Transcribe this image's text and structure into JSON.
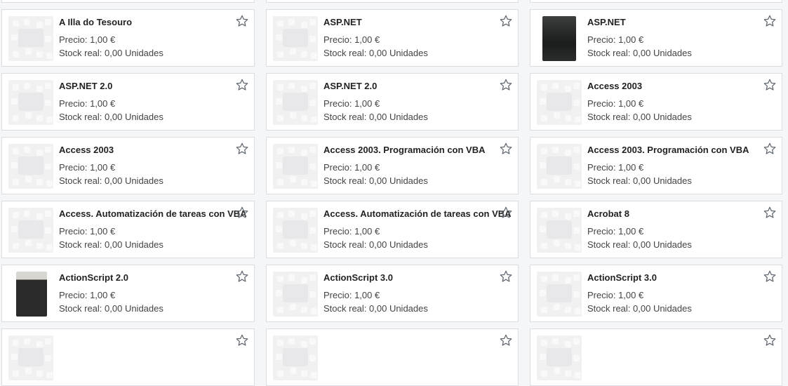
{
  "products": [
    {
      "title": "",
      "price": "",
      "stock": "",
      "cover": false,
      "partial": true
    },
    {
      "title": "",
      "price": "",
      "stock": "",
      "cover": false,
      "partial": true
    },
    {
      "title": "",
      "price": "",
      "stock": "",
      "cover": false,
      "partial": true
    },
    {
      "title": "A Illa do Tesouro",
      "price": "Precio: 1,00 €",
      "stock": "Stock real: 0,00 Unidades",
      "cover": false
    },
    {
      "title": "ASP.NET",
      "price": "Precio: 1,00 €",
      "stock": "Stock real: 0,00 Unidades",
      "cover": false
    },
    {
      "title": "ASP.NET",
      "price": "Precio: 1,00 €",
      "stock": "Stock real: 0,00 Unidades",
      "cover": "a"
    },
    {
      "title": "ASP.NET 2.0",
      "price": "Precio: 1,00 €",
      "stock": "Stock real: 0,00 Unidades",
      "cover": false
    },
    {
      "title": "ASP.NET 2.0",
      "price": "Precio: 1,00 €",
      "stock": "Stock real: 0,00 Unidades",
      "cover": false
    },
    {
      "title": "Access 2003",
      "price": "Precio: 1,00 €",
      "stock": "Stock real: 0,00 Unidades",
      "cover": false
    },
    {
      "title": "Access 2003",
      "price": "Precio: 1,00 €",
      "stock": "Stock real: 0,00 Unidades",
      "cover": false
    },
    {
      "title": "Access 2003. Programación con VBA",
      "price": "Precio: 1,00 €",
      "stock": "Stock real: 0,00 Unidades",
      "cover": false
    },
    {
      "title": "Access 2003. Programación con VBA",
      "price": "Precio: 1,00 €",
      "stock": "Stock real: 0,00 Unidades",
      "cover": false
    },
    {
      "title": "Access. Automatización de tareas con VBA",
      "price": "Precio: 1,00 €",
      "stock": "Stock real: 0,00 Unidades",
      "cover": false
    },
    {
      "title": "Access. Automatización de tareas con VBA",
      "price": "Precio: 1,00 €",
      "stock": "Stock real: 0,00 Unidades",
      "cover": false
    },
    {
      "title": "Acrobat 8",
      "price": "Precio: 1,00 €",
      "stock": "Stock real: 0,00 Unidades",
      "cover": false
    },
    {
      "title": "ActionScript 2.0",
      "price": "Precio: 1,00 €",
      "stock": "Stock real: 0,00 Unidades",
      "cover": "b"
    },
    {
      "title": "ActionScript 3.0",
      "price": "Precio: 1,00 €",
      "stock": "Stock real: 0,00 Unidades",
      "cover": false
    },
    {
      "title": "ActionScript 3.0",
      "price": "Precio: 1,00 €",
      "stock": "Stock real: 0,00 Unidades",
      "cover": false
    },
    {
      "title": "",
      "price": "",
      "stock": "",
      "cover": false,
      "partial": true
    },
    {
      "title": "",
      "price": "",
      "stock": "",
      "cover": false,
      "partial": true
    },
    {
      "title": "",
      "price": "",
      "stock": "",
      "cover": false,
      "partial": true
    }
  ]
}
